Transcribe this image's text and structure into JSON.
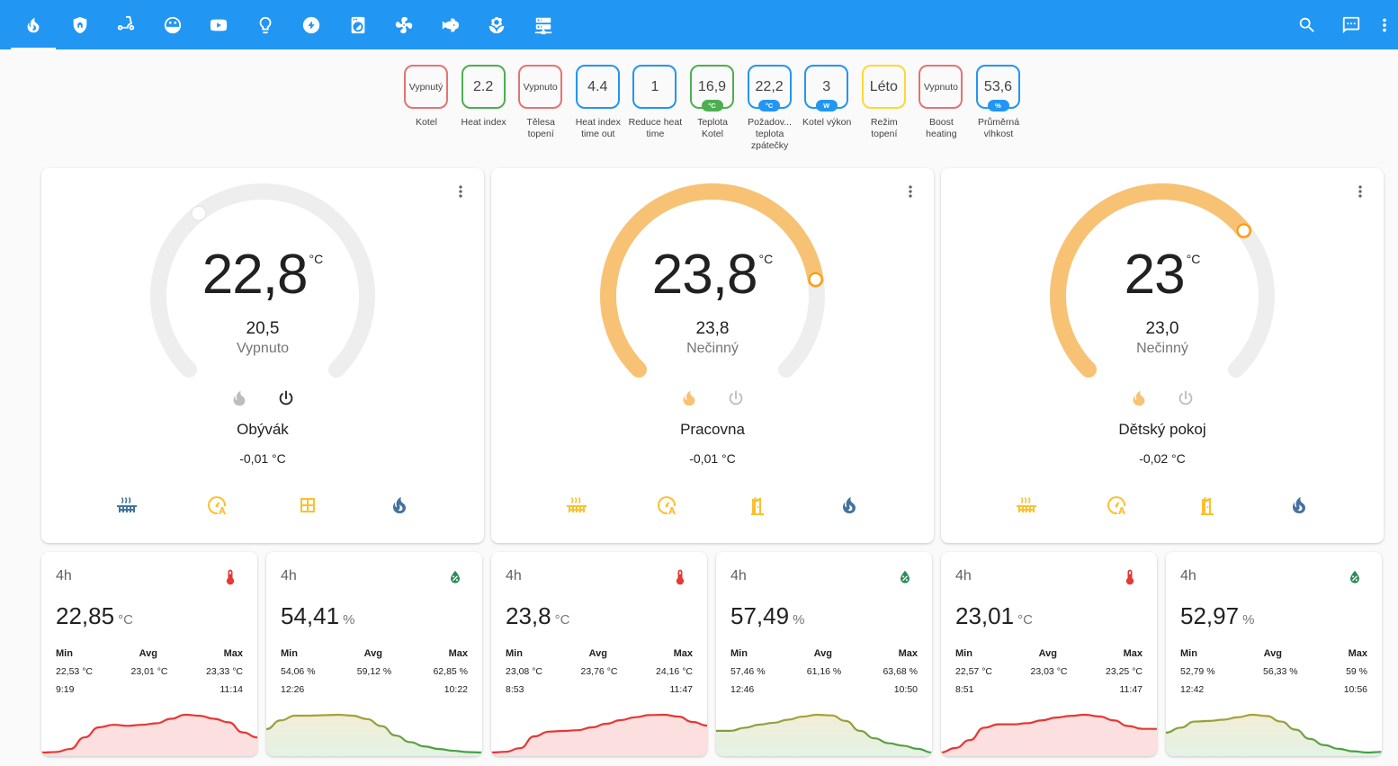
{
  "colors": {
    "primary": "#2196f3",
    "active_heat": "#f7c274",
    "track": "#eeeeee",
    "red_border": "#e57373",
    "green_border": "#4caf50",
    "blue_border": "#2196f3",
    "yellow_border": "#fdd835",
    "temp_line": "#e53935",
    "temp_fill": "#fbd9d9",
    "hum_line": "#43a047"
  },
  "toolbar": {
    "tabs": [
      {
        "icon": "fire-icon"
      },
      {
        "icon": "home-shield-icon"
      },
      {
        "icon": "scooter-icon"
      },
      {
        "icon": "robot-vacuum-icon"
      },
      {
        "icon": "youtube-icon"
      },
      {
        "icon": "lightbulb-icon"
      },
      {
        "icon": "flash-icon"
      },
      {
        "icon": "washing-machine-icon"
      },
      {
        "icon": "fan-icon"
      },
      {
        "icon": "fish-icon"
      },
      {
        "icon": "flower-icon"
      },
      {
        "icon": "server-icon"
      }
    ],
    "actions": [
      {
        "icon": "search-icon"
      },
      {
        "icon": "message-icon"
      },
      {
        "icon": "more-vertical-icon"
      }
    ]
  },
  "badges": [
    {
      "value": "Vypnutý",
      "unit": "",
      "label": "Kotel",
      "color": "red",
      "small": true
    },
    {
      "value": "2.2",
      "unit": "",
      "label": "Heat index",
      "color": "green",
      "small": false
    },
    {
      "value": "Vypnuto",
      "unit": "",
      "label": "Tělesa topení",
      "color": "red",
      "small": true
    },
    {
      "value": "4.4",
      "unit": "",
      "label": "Heat index time out",
      "color": "blue",
      "small": false
    },
    {
      "value": "1",
      "unit": "",
      "label": "Reduce heat time",
      "color": "blue",
      "small": false
    },
    {
      "value": "16,9",
      "unit": "°C",
      "label": "Teplota Kotel",
      "color": "green",
      "small": false
    },
    {
      "value": "22,2",
      "unit": "°C",
      "label": "Požadov... teplota zpátečky",
      "color": "blue",
      "small": false
    },
    {
      "value": "3",
      "unit": "W",
      "label": "Kotel výkon",
      "color": "blue",
      "small": false
    },
    {
      "value": "Léto",
      "unit": "",
      "label": "Režim topení",
      "color": "yellow",
      "small": false
    },
    {
      "value": "Vypnuto",
      "unit": "",
      "label": "Boost heating",
      "color": "red",
      "small": true
    },
    {
      "value": "53,6",
      "unit": "%",
      "label": "Průměrná vlhkost",
      "color": "blue",
      "small": false
    }
  ],
  "thermostats": [
    {
      "current": "22,8",
      "unit": "°C",
      "target": "20,5",
      "status": "Vypnuto",
      "room": "Obývák",
      "offset": "-0,01 °C",
      "active": false,
      "level": 0.36,
      "window_icon": "window-closed-icon"
    },
    {
      "current": "23,8",
      "unit": "°C",
      "target": "23,8",
      "status": "Nečinný",
      "room": "Pracovna",
      "offset": "-0,01 °C",
      "active": true,
      "level": 0.8,
      "window_icon": "door-open-icon"
    },
    {
      "current": "23",
      "unit": "°C",
      "target": "23,0",
      "status": "Nečinný",
      "room": "Dětský pokoj",
      "offset": "-0,02 °C",
      "active": true,
      "level": 0.69,
      "window_icon": "door-open-icon"
    }
  ],
  "sensors": [
    {
      "period": "4h",
      "type": "temp",
      "value": "22,85",
      "unit": "°C",
      "min_label": "Min",
      "avg_label": "Avg",
      "max_label": "Max",
      "min": "22,53 °C",
      "avg": "23,01 °C",
      "max": "23,33 °C",
      "min_time": "9:19",
      "max_time": "11:14",
      "series": [
        22.55,
        22.56,
        22.62,
        22.85,
        23.05,
        23.1,
        23.08,
        23.1,
        23.13,
        23.22,
        23.3,
        23.28,
        23.22,
        23.15,
        22.95,
        22.85
      ]
    },
    {
      "period": "4h",
      "type": "hum",
      "value": "54,41",
      "unit": "%",
      "min_label": "Min",
      "avg_label": "Avg",
      "max_label": "Max",
      "min": "54,06 %",
      "avg": "59,12 %",
      "max": "62,85 %",
      "min_time": "12:26",
      "max_time": "10:22",
      "series": [
        59.5,
        61.5,
        62.6,
        62.6,
        62.7,
        62.8,
        62.6,
        61.8,
        60.2,
        58.0,
        56.5,
        55.5,
        54.9,
        54.5,
        54.2,
        54.1
      ]
    },
    {
      "period": "4h",
      "type": "temp",
      "value": "23,8",
      "unit": "°C",
      "min_label": "Min",
      "avg_label": "Avg",
      "max_label": "Max",
      "min": "23,08 °C",
      "avg": "23,76 °C",
      "max": "24,16 °C",
      "min_time": "8:53",
      "max_time": "11:47",
      "series": [
        23.1,
        23.12,
        23.22,
        23.55,
        23.68,
        23.7,
        23.72,
        23.8,
        23.9,
        24.0,
        24.08,
        24.14,
        24.15,
        24.1,
        23.95,
        23.85
      ]
    },
    {
      "period": "4h",
      "type": "hum",
      "value": "57,49",
      "unit": "%",
      "min_label": "Min",
      "avg_label": "Avg",
      "max_label": "Max",
      "min": "57,46 %",
      "avg": "61,16 %",
      "max": "63,68 %",
      "min_time": "12:46",
      "max_time": "10:50",
      "series": [
        61.0,
        61.0,
        61.5,
        62.0,
        62.3,
        62.8,
        63.3,
        63.6,
        63.5,
        62.6,
        61.0,
        59.8,
        59.0,
        58.6,
        58.1,
        57.5
      ]
    },
    {
      "period": "4h",
      "type": "temp",
      "value": "23,01",
      "unit": "°C",
      "min_label": "Min",
      "avg_label": "Avg",
      "max_label": "Max",
      "min": "22,57 °C",
      "avg": "23,03 °C",
      "max": "23,25 °C",
      "min_time": "8:51",
      "max_time": "11:47",
      "series": [
        22.58,
        22.66,
        22.8,
        23.02,
        23.08,
        23.08,
        23.1,
        23.15,
        23.2,
        23.23,
        23.25,
        23.22,
        23.15,
        23.05,
        23.0,
        23.0
      ]
    },
    {
      "period": "4h",
      "type": "hum",
      "value": "52,97",
      "unit": "%",
      "min_label": "Min",
      "avg_label": "Avg",
      "max_label": "Max",
      "min": "52,79 %",
      "avg": "56,33 %",
      "max": "59 %",
      "min_time": "12:42",
      "max_time": "10:56",
      "series": [
        56.0,
        56.8,
        57.8,
        57.9,
        58.1,
        58.5,
        58.9,
        58.7,
        57.8,
        56.5,
        55.0,
        54.0,
        53.4,
        53.0,
        52.8,
        52.9
      ]
    }
  ]
}
